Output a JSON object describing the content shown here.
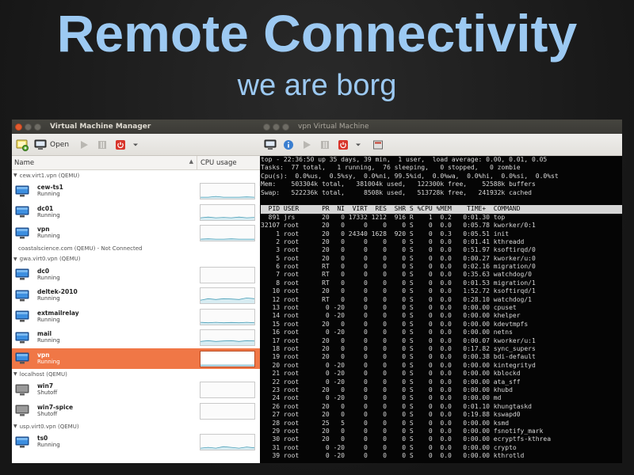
{
  "slide": {
    "title": "Remote Connectivity",
    "subtitle": "we are borg"
  },
  "vmm": {
    "window_title": "Virtual Machine Manager",
    "toolbar": {
      "open_label": "Open"
    },
    "columns": {
      "name": "Name",
      "cpu": "CPU usage"
    },
    "groups": [
      {
        "label": "cew.virt1.vpn (QEMU)",
        "expanded": true,
        "vms": [
          {
            "name": "cew-ts1",
            "status": "Running",
            "cpu": [
              0.1,
              0.1,
              0.15,
              0.1,
              0.1,
              0.1,
              0.12,
              0.1
            ]
          },
          {
            "name": "dc01",
            "status": "Running",
            "cpu": [
              0.15,
              0.2,
              0.15,
              0.18,
              0.15,
              0.2,
              0.15,
              0.18
            ]
          },
          {
            "name": "vpn",
            "status": "Running",
            "cpu": [
              0.1,
              0.12,
              0.1,
              0.1,
              0.12,
              0.1,
              0.1,
              0.1
            ]
          }
        ]
      },
      {
        "label": "coastalscience.com (QEMU) - Not Connected",
        "expanded": false,
        "vms": []
      },
      {
        "label": "gwa.virt0.vpn (QEMU)",
        "expanded": true,
        "vms": [
          {
            "name": "dc0",
            "status": "Running",
            "cpu": []
          },
          {
            "name": "deltek-2010",
            "status": "Running",
            "cpu": [
              0.2,
              0.3,
              0.25,
              0.3,
              0.28,
              0.25,
              0.35,
              0.3
            ]
          },
          {
            "name": "extmailrelay",
            "status": "Running",
            "cpu": [
              0.15,
              0.12,
              0.15,
              0.12,
              0.14,
              0.12,
              0.15,
              0.12
            ]
          },
          {
            "name": "mail",
            "status": "Running",
            "cpu": [
              0.25,
              0.3,
              0.25,
              0.28,
              0.3,
              0.25,
              0.3,
              0.28
            ]
          },
          {
            "name": "vpn",
            "status": "Running",
            "cpu": [
              0.1,
              0.1,
              0.1,
              0.1,
              0.1,
              0.1,
              0.1,
              0.1
            ],
            "selected": true
          }
        ]
      },
      {
        "label": "localhost (QEMU)",
        "expanded": false,
        "vms": [
          {
            "name": "win7",
            "status": "Shutoff",
            "cpu": []
          },
          {
            "name": "win7-spice",
            "status": "Shutoff",
            "cpu": []
          }
        ]
      },
      {
        "label": "usp.virt0.vpn (QEMU)",
        "expanded": true,
        "vms": [
          {
            "name": "ts0",
            "status": "Running",
            "cpu": [
              0.1,
              0.15,
              0.1,
              0.2,
              0.15,
              0.1,
              0.18,
              0.12
            ]
          }
        ]
      }
    ]
  },
  "terminal": {
    "window_title": "vpn Virtual Machine",
    "summary": [
      "top - 22:36:50 up 35 days, 39 min,  1 user,  load average: 0.00, 0.01, 0.05",
      "Tasks:  77 total,   1 running,  76 sleeping,   0 stopped,   0 zombie",
      "Cpu(s):  0.0%us,  0.5%sy,  0.0%ni, 99.5%id,  0.0%wa,  0.0%hi,  0.0%si,  0.0%st",
      "Mem:    503304k total,   381004k used,   122300k free,    52588k buffers",
      "Swap:   522236k total,     8508k used,   513728k free,   241932k cached"
    ],
    "header": "  PID USER      PR  NI  VIRT  RES  SHR S %CPU %MEM    TIME+  COMMAND",
    "processes": [
      "  891 jrs       20   0 17332 1212  916 R    1  0.2   0:01.30 top",
      "32107 root      20   0     0    0    0 S    0  0.0   0:05.78 kworker/0:1",
      "    1 root      20   0 24340 1628  920 S    0  0.3   0:05.51 init",
      "    2 root      20   0     0    0    0 S    0  0.0   0:01.41 kthreadd",
      "    3 root      20   0     0    0    0 S    0  0.0   0:51.97 ksoftirqd/0",
      "    5 root      20   0     0    0    0 S    0  0.0   0:00.27 kworker/u:0",
      "    6 root      RT   0     0    0    0 S    0  0.0   0:02.16 migration/0",
      "    7 root      RT   0     0    0    0 S    0  0.0   0:35.63 watchdog/0",
      "    8 root      RT   0     0    0    0 S    0  0.0   0:01.53 migration/1",
      "   10 root      20   0     0    0    0 S    0  0.0   1:52.72 ksoftirqd/1",
      "   12 root      RT   0     0    0    0 S    0  0.0   0:28.10 watchdog/1",
      "   13 root       0 -20     0    0    0 S    0  0.0   0:00.00 cpuset",
      "   14 root       0 -20     0    0    0 S    0  0.0   0:00.00 khelper",
      "   15 root      20   0     0    0    0 S    0  0.0   0:00.00 kdevtmpfs",
      "   16 root       0 -20     0    0    0 S    0  0.0   0:00.00 netns",
      "   17 root      20   0     0    0    0 S    0  0.0   0:00.07 kworker/u:1",
      "   18 root      20   0     0    0    0 S    0  0.0   0:17.82 sync_supers",
      "   19 root      20   0     0    0    0 S    0  0.0   0:00.38 bdi-default",
      "   20 root       0 -20     0    0    0 S    0  0.0   0:00.00 kintegrityd",
      "   21 root       0 -20     0    0    0 S    0  0.0   0:00.00 kblockd",
      "   22 root       0 -20     0    0    0 S    0  0.0   0:00.00 ata_sff",
      "   23 root      20   0     0    0    0 S    0  0.0   0:00.00 khubd",
      "   24 root       0 -20     0    0    0 S    0  0.0   0:00.00 md",
      "   26 root      20   0     0    0    0 S    0  0.0   0:01.10 khungtaskd",
      "   27 root      20   0     0    0    0 S    0  0.0   0:19.88 kswapd0",
      "   28 root      25   5     0    0    0 S    0  0.0   0:00.00 ksmd",
      "   29 root      20   0     0    0    0 S    0  0.0   0:00.00 fsnotify_mark",
      "   30 root      20   0     0    0    0 S    0  0.0   0:00.00 ecryptfs-kthrea",
      "   31 root       0 -20     0    0    0 S    0  0.0   0:00.00 crypto",
      "   39 root       0 -20     0    0    0 S    0  0.0   0:00.00 kthrotld"
    ]
  },
  "colors": {
    "title": "#9cc9f2",
    "selection": "#f07746",
    "close_button": "#e25a2f",
    "monitor_icon": "#2d6db5"
  },
  "icons": [
    "monitor-icon",
    "info-icon",
    "play-icon",
    "pause-icon",
    "power-icon",
    "chevron-down-icon",
    "fullscreen-icon",
    "new-vm-icon"
  ]
}
